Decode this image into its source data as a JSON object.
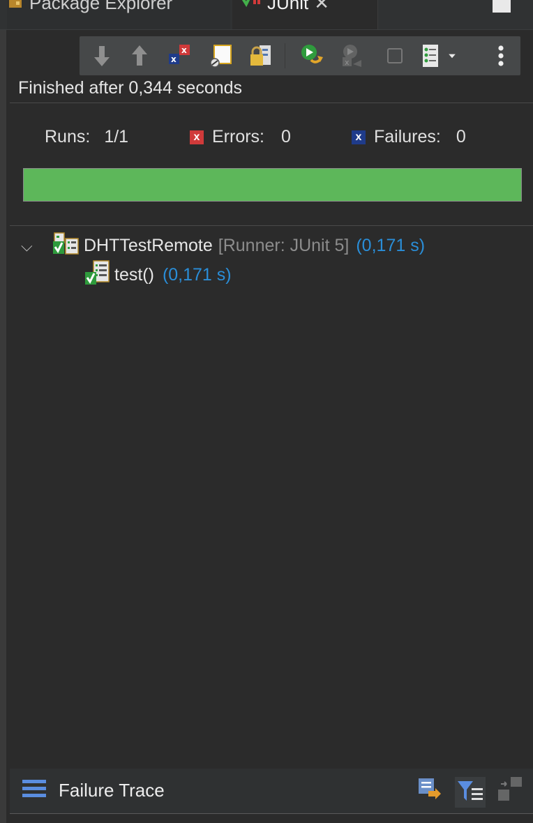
{
  "tabs": [
    {
      "label": "Package Explorer",
      "icon": "package-explorer-icon"
    },
    {
      "label": "JUnit",
      "icon": "junit-icon",
      "close": "✕"
    }
  ],
  "toolbar": {
    "buttons": [
      {
        "name": "next-failure-button",
        "icon": "arrow-down-icon"
      },
      {
        "name": "previous-failure-button",
        "icon": "arrow-up-icon"
      },
      {
        "name": "show-failures-only-button",
        "icon": "failures-only-icon"
      },
      {
        "name": "show-skipped-button",
        "icon": "skipped-icon"
      },
      {
        "name": "scroll-lock-button",
        "icon": "lock-icon"
      },
      {
        "name": "rerun-button",
        "icon": "rerun-icon"
      },
      {
        "name": "rerun-failed-first-button",
        "icon": "rerun-failed-icon"
      },
      {
        "name": "stop-button",
        "icon": "stop-icon"
      },
      {
        "name": "test-run-history-button",
        "icon": "history-icon"
      },
      {
        "name": "view-menu-button",
        "icon": "kebab-menu-icon"
      }
    ]
  },
  "status": {
    "text": "Finished after 0,344 seconds"
  },
  "counters": {
    "runs_label": "Runs:",
    "runs_value": "1/1",
    "errors_label": "Errors:",
    "errors_value": "0",
    "failures_label": "Failures:",
    "failures_value": "0"
  },
  "progress": {
    "fraction": 1.0,
    "color": "#5db75a"
  },
  "tree": {
    "suite": {
      "name": "DHTTestRemote",
      "runner": "[Runner: JUnit 5]",
      "time": "(0,171 s)"
    },
    "tests": [
      {
        "name": "test()",
        "time": "(0,171 s)"
      }
    ]
  },
  "failure_trace": {
    "label": "Failure Trace"
  },
  "colors": {
    "error": "#d03a3a",
    "failure": "#1f3b8a",
    "time": "#2a8ed8",
    "pass": "#5db75a"
  }
}
